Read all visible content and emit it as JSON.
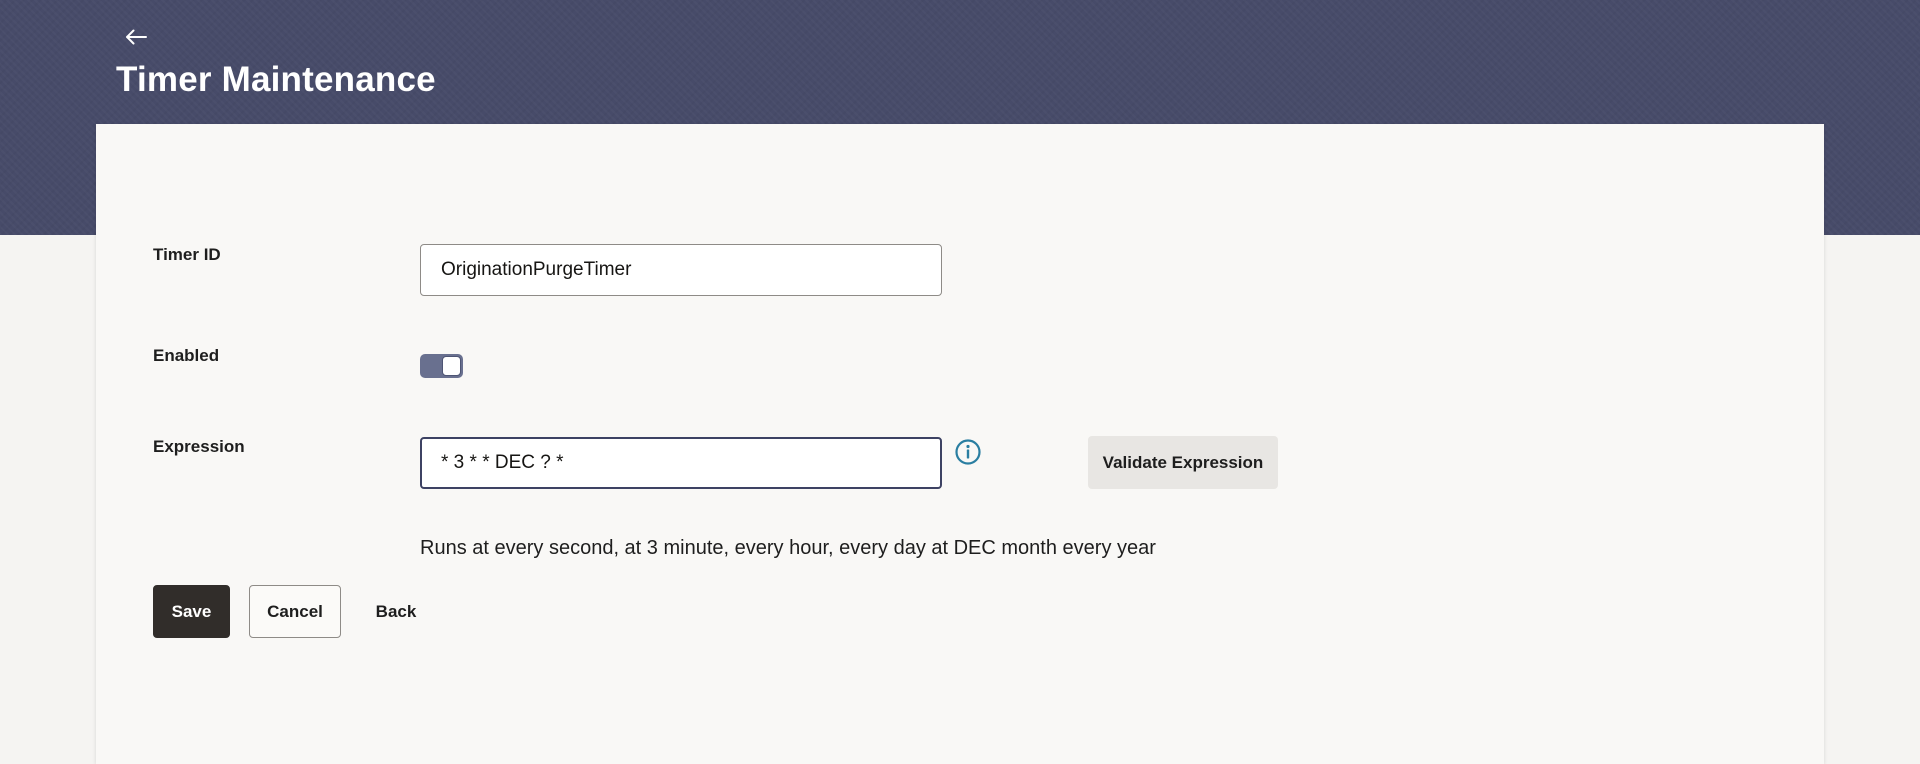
{
  "header": {
    "title": "Timer Maintenance",
    "back_icon": "arrow-left-icon"
  },
  "form": {
    "timer_id": {
      "label": "Timer ID",
      "value": "OriginationPurgeTimer"
    },
    "enabled": {
      "label": "Enabled",
      "checked": true
    },
    "expression": {
      "label": "Expression",
      "value": "* 3 * * DEC ? *",
      "info_icon": "info-icon"
    },
    "validate_label": "Validate Expression",
    "description": "Runs at every second, at 3 minute, every hour, every day at DEC month every year"
  },
  "actions": {
    "save_label": "Save",
    "cancel_label": "Cancel",
    "back_label": "Back"
  },
  "colors": {
    "header_bg": "#474b69",
    "primary_button": "#312d2a",
    "toggle_on": "#69708f",
    "info_icon": "#2a7ea1"
  }
}
